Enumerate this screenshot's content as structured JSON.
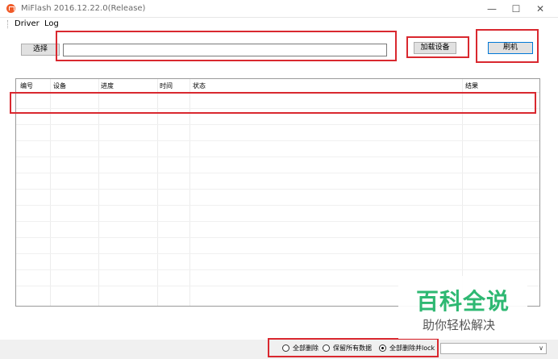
{
  "window": {
    "title": "MiFlash 2016.12.22.0(Release)",
    "minimize": "—",
    "maximize": "☐",
    "close": "✕"
  },
  "menu": {
    "items": [
      "Driver",
      "Log"
    ]
  },
  "toolbar": {
    "select_label": "选择",
    "path_value": "",
    "load_label": "加载设备",
    "flash_label": "刷机"
  },
  "grid": {
    "columns": [
      "编号",
      "设备",
      "进度",
      "时间",
      "状态",
      "结果"
    ],
    "rows": []
  },
  "bottom": {
    "options": [
      {
        "label": "全部删除",
        "checked": false
      },
      {
        "label": "保留所有数据",
        "checked": false
      },
      {
        "label": "全部删除并lock",
        "checked": true
      }
    ],
    "combo_value": "",
    "combo_arrow": "∨"
  },
  "watermark": {
    "title": "百科全说",
    "subtitle": "助你轻松解决"
  },
  "colors": {
    "highlight_red": "#d9282f",
    "watermark_green": "#2eb872",
    "app_icon": "#f05a28"
  }
}
